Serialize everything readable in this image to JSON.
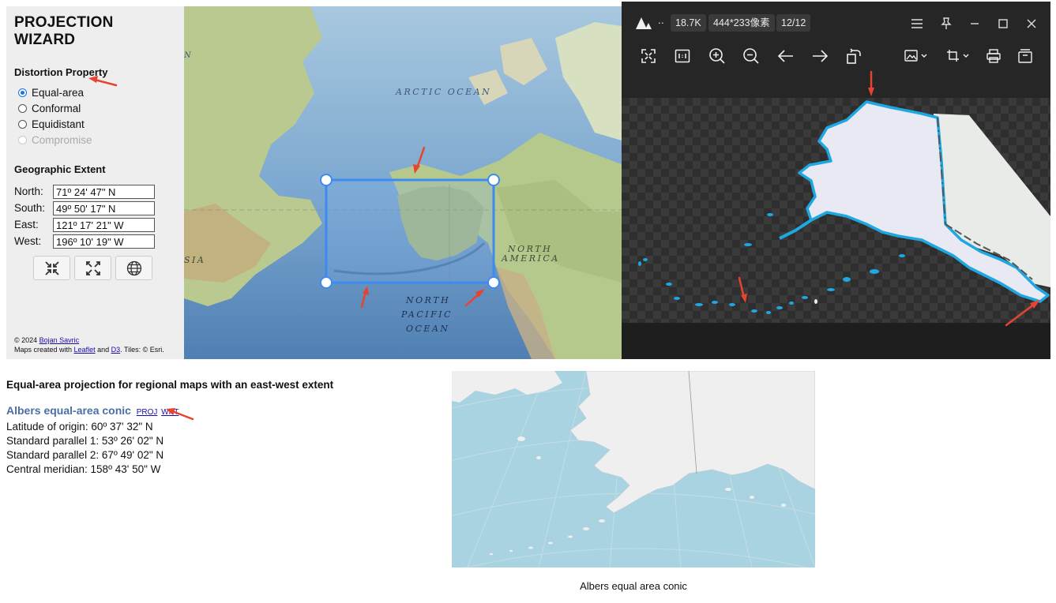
{
  "panel": {
    "title": "PROJECTION WIZARD",
    "distortion_heading": "Distortion Property",
    "options": [
      {
        "label": "Equal-area",
        "selected": true,
        "disabled": false
      },
      {
        "label": "Conformal",
        "selected": false,
        "disabled": false
      },
      {
        "label": "Equidistant",
        "selected": false,
        "disabled": false
      },
      {
        "label": "Compromise",
        "selected": false,
        "disabled": true
      }
    ],
    "extent_heading": "Geographic Extent",
    "extent": {
      "north_label": "North:",
      "north_value": "71º 24' 47\" N",
      "south_label": "South:",
      "south_value": "49º 50' 17\" N",
      "east_label": "East:",
      "east_value": "121º 17' 21\" W",
      "west_label": "West:",
      "west_value": "196º 10' 19\" W"
    },
    "buttons": [
      "shrink-icon",
      "expand-icon",
      "globe-icon"
    ],
    "credits": {
      "line1_prefix": "© 2024 ",
      "author": "Bojan Savric",
      "line2_prefix": "Maps created with ",
      "leaflet": "Leaflet",
      "and": " and ",
      "d3": "D3",
      "tiles": ". Tiles: © Esri."
    }
  },
  "map": {
    "labels": {
      "arctic": "ARCTIC OCEAN",
      "north_america_1": "NORTH",
      "north_america_2": "AMERICA",
      "pacific_1": "NORTH",
      "pacific_2": "PACIFIC",
      "pacific_3": "OCEAN",
      "asia": "SIA",
      "edge_n": "N"
    }
  },
  "viewer": {
    "title": "..",
    "file_size": "18.7K",
    "dimensions": "444*233像素",
    "counter": "12/12",
    "toolbar": [
      "fit-icon",
      "actual-size-icon",
      "zoom-in-icon",
      "zoom-out-icon",
      "prev-icon",
      "next-icon",
      "rotate-icon",
      "image-edit-icon",
      "crop-icon",
      "print-icon",
      "save-icon"
    ],
    "window_controls": [
      "menu-icon",
      "pin-icon",
      "minimize-icon",
      "maximize-icon",
      "close-icon"
    ]
  },
  "result": {
    "description": "Equal-area projection for regional maps with an east-west extent",
    "projection_name": "Albers equal-area conic",
    "proj_link": "PROJ",
    "wkt_link": "WKT",
    "lat_origin": "Latitude of origin: 60º 37' 32\" N",
    "std_parallel_1": "Standard parallel 1: 53º 26' 02\" N",
    "std_parallel_2": "Standard parallel 2: 67º 49' 02\" N",
    "central_meridian": "Central meridian: 158º 43' 50\" W",
    "caption": "Albers equal area conic"
  },
  "colors": {
    "accent": "#1a73e8",
    "selection_box": "#3d8bf0",
    "annotation_arrow": "#e8432e",
    "ocean": "#a9d3e0",
    "viewer_outline": "#1ea7e0"
  }
}
